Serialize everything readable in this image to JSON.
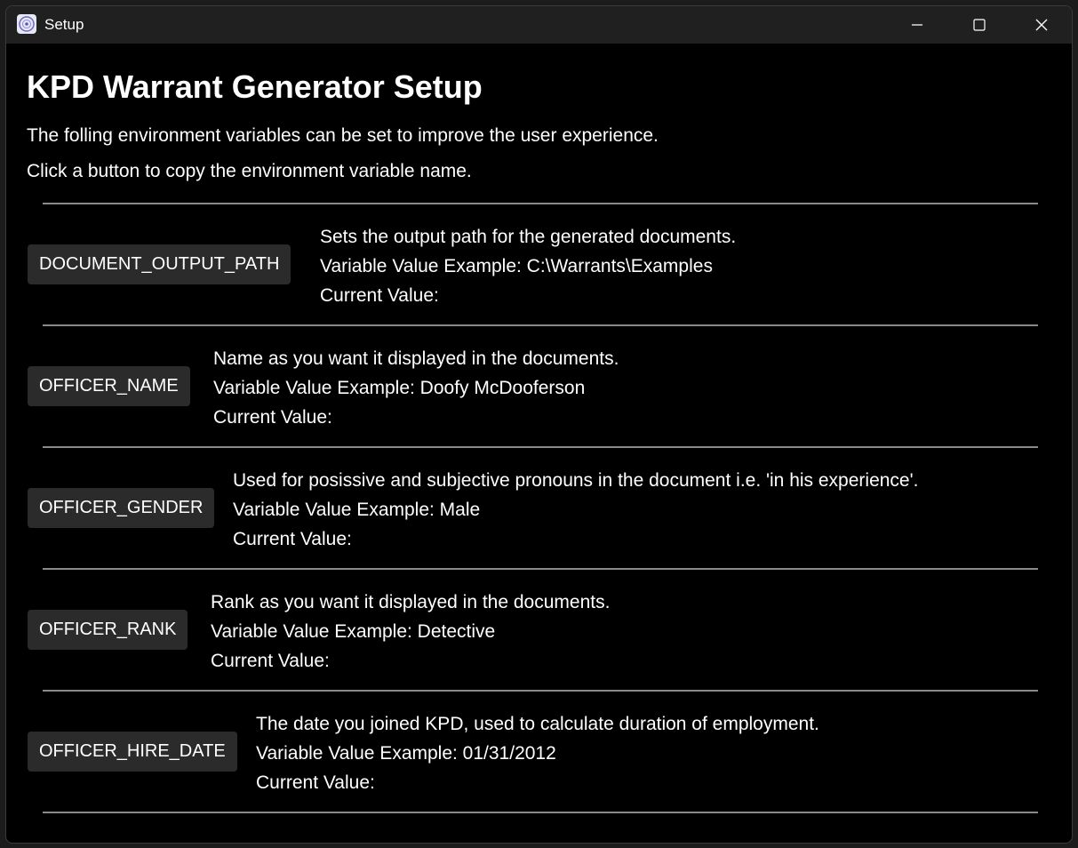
{
  "window": {
    "title": "Setup",
    "icon": "app-logo-icon"
  },
  "titlebar_controls": [
    "minimize-icon",
    "maximize-icon",
    "close-icon"
  ],
  "main": {
    "heading": "KPD Warrant Generator Setup",
    "intro_line_1": "The folling environment variables can be set to improve the user experience.",
    "intro_line_2": "Click a button to copy the environment variable name."
  },
  "variables": [
    {
      "button_label": "DOCUMENT_OUTPUT_PATH",
      "description": "Sets the output path for the generated documents.",
      "example": "Variable Value Example:  C:\\Warrants\\Examples",
      "current": "Current Value:"
    },
    {
      "button_label": "OFFICER_NAME",
      "description": "Name as you want it displayed in the documents.",
      "example": "Variable Value Example:  Doofy McDooferson",
      "current": "Current Value:"
    },
    {
      "button_label": "OFFICER_GENDER",
      "description": "Used for posissive and subjective pronouns in the document i.e. 'in his experience'.",
      "example": "Variable Value Example:  Male",
      "current": "Current Value:"
    },
    {
      "button_label": "OFFICER_RANK",
      "description": "Rank as you want it displayed in the documents.",
      "example": "Variable Value Example:  Detective",
      "current": "Current Value:"
    },
    {
      "button_label": "OFFICER_HIRE_DATE",
      "description": "The date you joined KPD, used to calculate duration of employment.",
      "example": "Variable Value Example:  01/31/2012",
      "current": "Current Value:"
    }
  ],
  "colors": {
    "background": "#000000",
    "titlebar": "#202020",
    "button": "#2b2b2b",
    "divider": "#8a8a8a",
    "text": "#ffffff"
  }
}
